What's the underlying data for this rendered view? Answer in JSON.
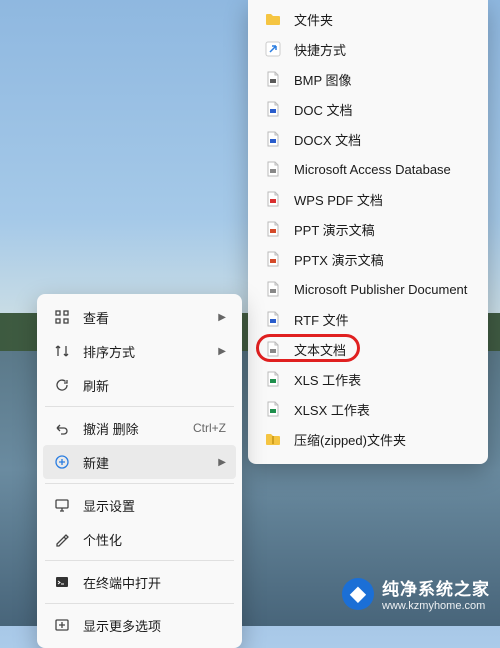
{
  "context_menu": {
    "items": [
      {
        "label": "查看",
        "icon": "view-grid-icon",
        "has_arrow": true
      },
      {
        "label": "排序方式",
        "icon": "sort-icon",
        "has_arrow": true
      },
      {
        "label": "刷新",
        "icon": "refresh-icon"
      }
    ],
    "items2": [
      {
        "label": "撤消 删除",
        "icon": "undo-icon",
        "shortcut": "Ctrl+Z"
      },
      {
        "label": "新建",
        "icon": "new-icon",
        "has_arrow": true,
        "highlighted": true
      }
    ],
    "items3": [
      {
        "label": "显示设置",
        "icon": "display-icon"
      },
      {
        "label": "个性化",
        "icon": "personalize-icon"
      }
    ],
    "items4": [
      {
        "label": "在终端中打开",
        "icon": "terminal-icon"
      }
    ],
    "items5": [
      {
        "label": "显示更多选项",
        "icon": "more-options-icon"
      }
    ]
  },
  "submenu": {
    "items": [
      {
        "label": "文件夹",
        "icon": "folder-icon",
        "color": "#f0c050"
      },
      {
        "label": "快捷方式",
        "icon": "shortcut-icon",
        "color": "#2a7de1"
      },
      {
        "label": "BMP 图像",
        "icon": "bmp-icon",
        "color": "#5a5a5a"
      },
      {
        "label": "DOC 文档",
        "icon": "doc-icon",
        "color": "#2a5dcc"
      },
      {
        "label": "DOCX 文档",
        "icon": "docx-icon",
        "color": "#2a5dcc"
      },
      {
        "label": "Microsoft Access Database",
        "icon": "access-icon",
        "color": "#888"
      },
      {
        "label": "WPS PDF 文档",
        "icon": "pdf-icon",
        "color": "#d93030"
      },
      {
        "label": "PPT 演示文稿",
        "icon": "ppt-icon",
        "color": "#d44a2a"
      },
      {
        "label": "PPTX 演示文稿",
        "icon": "pptx-icon",
        "color": "#d44a2a"
      },
      {
        "label": "Microsoft Publisher Document",
        "icon": "publisher-icon",
        "color": "#888"
      },
      {
        "label": "RTF 文件",
        "icon": "rtf-icon",
        "color": "#2a5dcc"
      },
      {
        "label": "文本文档",
        "icon": "txt-icon",
        "color": "#888",
        "ring": true
      },
      {
        "label": "XLS 工作表",
        "icon": "xls-icon",
        "color": "#1f8f4d"
      },
      {
        "label": "XLSX 工作表",
        "icon": "xlsx-icon",
        "color": "#1f8f4d"
      },
      {
        "label": "压缩(zipped)文件夹",
        "icon": "zip-icon",
        "color": "#e0b040"
      }
    ]
  },
  "watermark": {
    "title": "纯净系统之家",
    "url": "www.kzmyhome.com"
  }
}
